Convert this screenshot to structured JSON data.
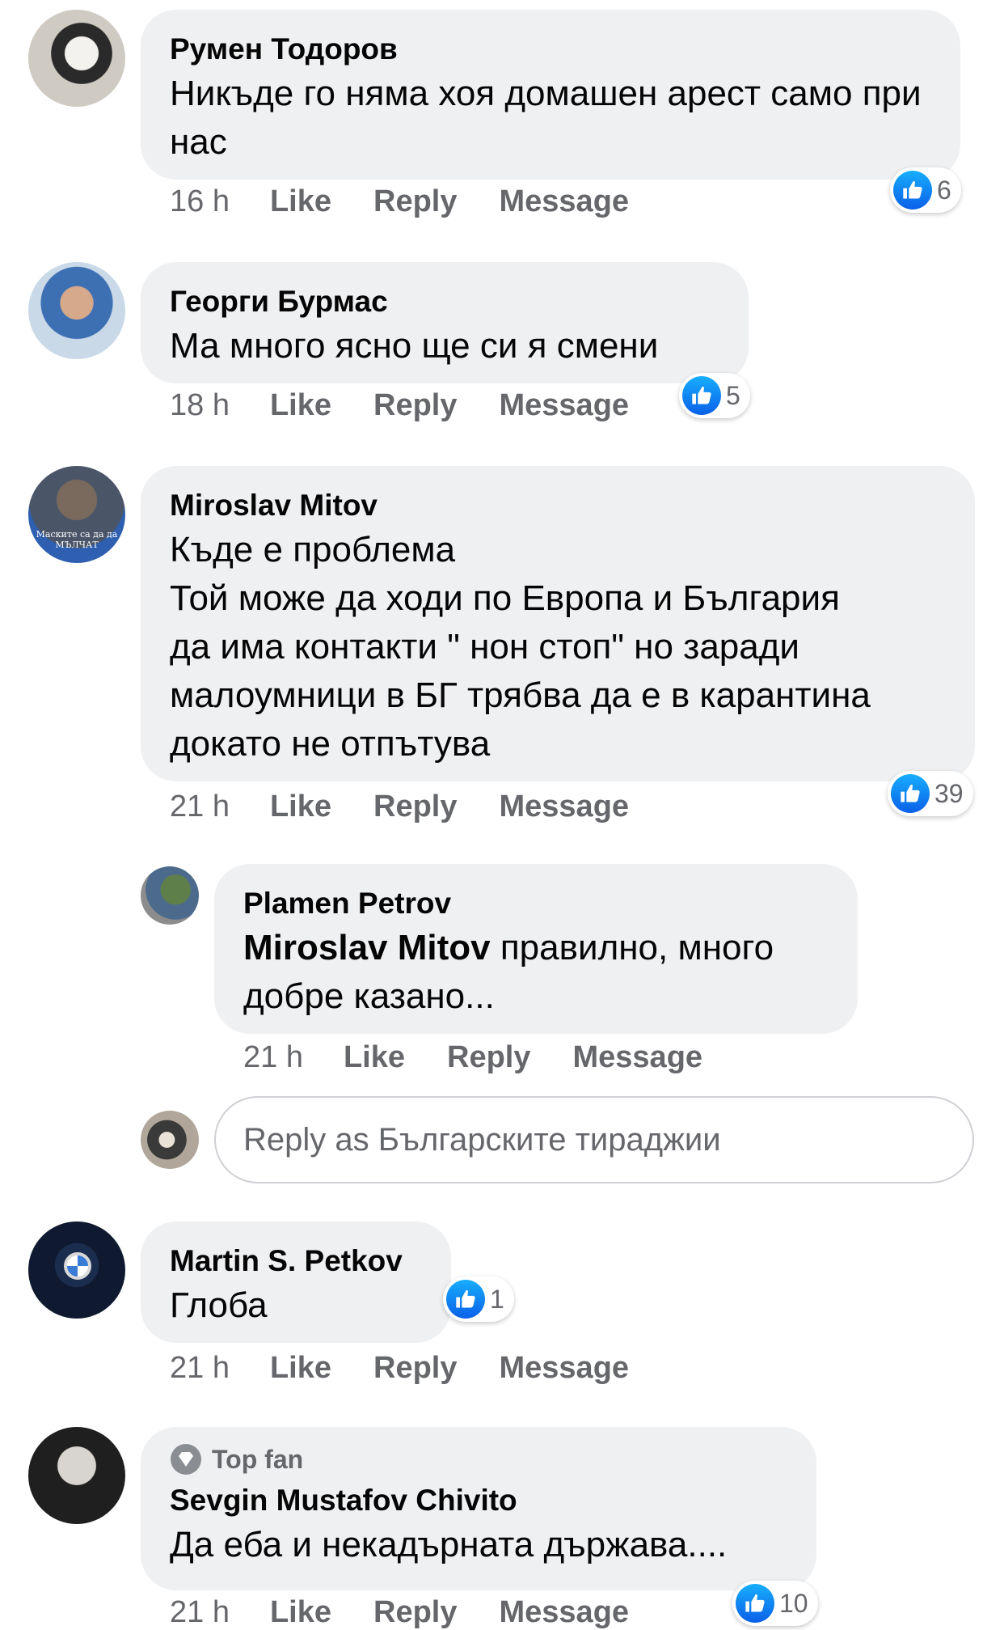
{
  "comments": [
    {
      "author": "Румен Тодоров",
      "text": "Никъде го няма хоя домашен арест само при нас",
      "time": "16 h",
      "reactions": "6"
    },
    {
      "author": "Георги Бурмас",
      "text": "Ма много ясно ще си я смени",
      "time": "18 h",
      "reactions": "5"
    },
    {
      "author": "Miroslav Mitov",
      "text": "Къде е проблема\nТой може да ходи по Европа и България\nда има контакти \" нон стоп\" но заради\nмалоумници в БГ трябва да е в карантина\nдокато не отпътува",
      "avatar_caption": "Маските са да да МЪЛЧАТ",
      "time": "21 h",
      "reactions": "39",
      "reply": {
        "author": "Plamen Petrov",
        "mention": "Miroslav Mitov",
        "text": " правилно, много\nдобре казано...",
        "time": "21 h"
      }
    },
    {
      "author": "Martin S. Petkov",
      "text": "Глоба",
      "time": "21 h",
      "reactions": "1"
    },
    {
      "badge": "Top fan",
      "author": "Sevgin Mustafov Chivito",
      "text": "Да еба и некадърната държава....",
      "time": "21 h",
      "reactions": "10"
    }
  ],
  "actions": {
    "like": "Like",
    "reply": "Reply",
    "message": "Message"
  },
  "reply_box": {
    "placeholder": "Reply as Българските тираджии"
  },
  "colors": {
    "bubble": "#eff0f2",
    "meta_text": "#65676b",
    "like_blue": "#1877f2"
  }
}
